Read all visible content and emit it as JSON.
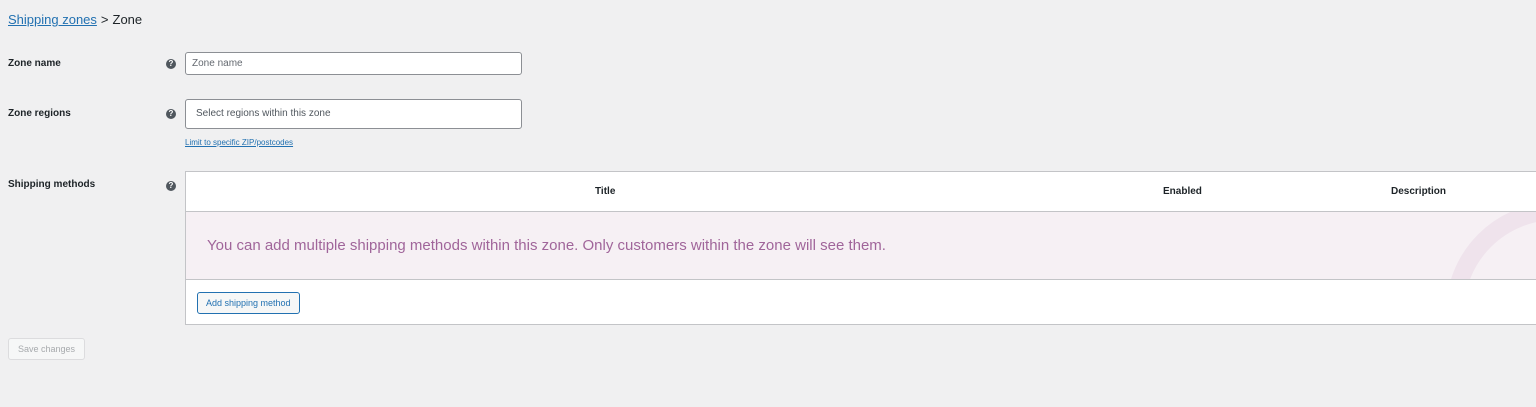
{
  "breadcrumb": {
    "parent": "Shipping zones",
    "separator": ">",
    "current": "Zone"
  },
  "zone_name": {
    "label": "Zone name",
    "placeholder": "Zone name",
    "value": ""
  },
  "zone_regions": {
    "label": "Zone regions",
    "placeholder": "Select regions within this zone",
    "postcode_link": "Limit to specific ZIP/postcodes"
  },
  "shipping_methods": {
    "label": "Shipping methods",
    "columns": [
      "Title",
      "Enabled",
      "Description"
    ],
    "blank_message": "You can add multiple shipping methods within this zone. Only customers within the zone will see them.",
    "add_button": "Add shipping method"
  },
  "help_icon": "question-circle-icon",
  "save_button": "Save changes",
  "colors": {
    "link": "#2271b1",
    "blank_bg": "#f6f0f4",
    "blank_text": "#a0659a"
  }
}
